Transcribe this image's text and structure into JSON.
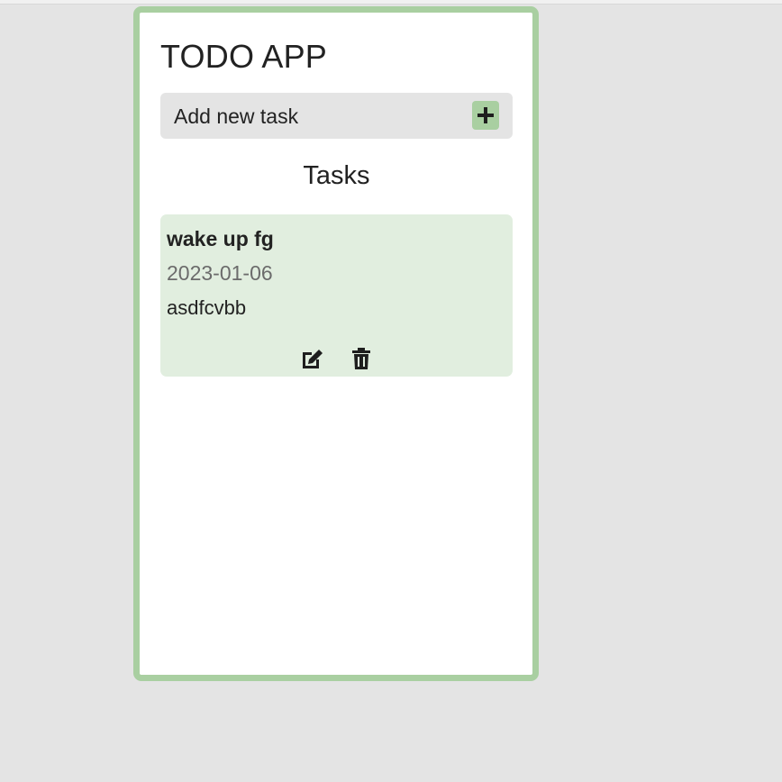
{
  "app": {
    "title": "TODO APP",
    "accent_color": "#a9cfa1",
    "background_color": "#e4e4e4"
  },
  "add_task": {
    "label": "Add new task",
    "button_icon": "plus-icon"
  },
  "tasks_section": {
    "title": "Tasks",
    "items": [
      {
        "title": "wake up fg",
        "date": "2023-01-06",
        "description": "asdfcvbb",
        "card_color": "#e1eedf",
        "actions": [
          "edit-icon",
          "trash-icon"
        ]
      }
    ]
  }
}
